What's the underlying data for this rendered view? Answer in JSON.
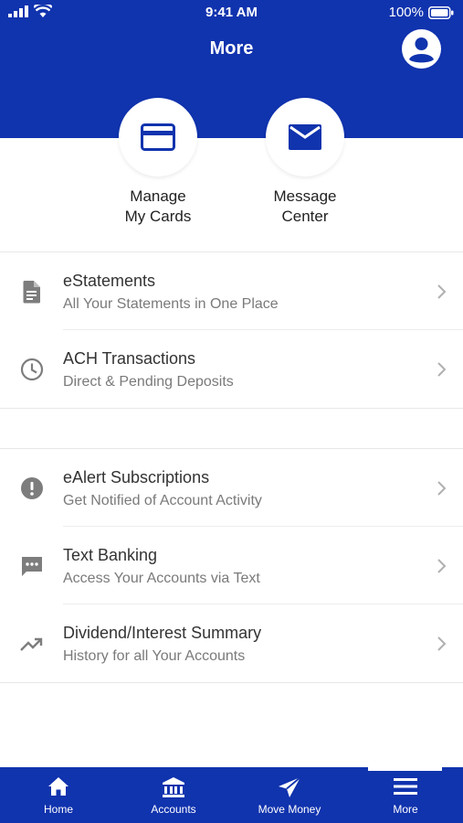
{
  "status_bar": {
    "time": "9:41 AM",
    "battery": "100%"
  },
  "header": {
    "title": "More"
  },
  "quick_actions": [
    {
      "label_line1": "Manage",
      "label_line2": "My Cards",
      "icon": "credit-card-icon"
    },
    {
      "label_line1": "Message",
      "label_line2": "Center",
      "icon": "envelope-icon"
    }
  ],
  "menu": {
    "group1": [
      {
        "title": "eStatements",
        "subtitle": "All Your Statements in One Place",
        "icon": "document-icon"
      },
      {
        "title": "ACH Transactions",
        "subtitle": "Direct & Pending Deposits",
        "icon": "clock-icon"
      }
    ],
    "group2": [
      {
        "title": "eAlert Subscriptions",
        "subtitle": "Get Notified of Account Activity",
        "icon": "alert-icon"
      },
      {
        "title": "Text Banking",
        "subtitle": "Access Your Accounts via Text",
        "icon": "chat-icon"
      },
      {
        "title": "Dividend/Interest Summary",
        "subtitle": "History for all Your Accounts",
        "icon": "trending-up-icon"
      }
    ]
  },
  "tabbar": {
    "items": [
      {
        "label": "Home",
        "icon": "home-icon"
      },
      {
        "label": "Accounts",
        "icon": "bank-icon"
      },
      {
        "label": "Move Money",
        "icon": "send-icon"
      },
      {
        "label": "More",
        "icon": "menu-icon"
      }
    ],
    "active": "More"
  },
  "colors": {
    "brand": "#1033AE",
    "icon_gray": "#7d7d7d",
    "text": "#333333",
    "subtext": "#7a7a7a"
  }
}
